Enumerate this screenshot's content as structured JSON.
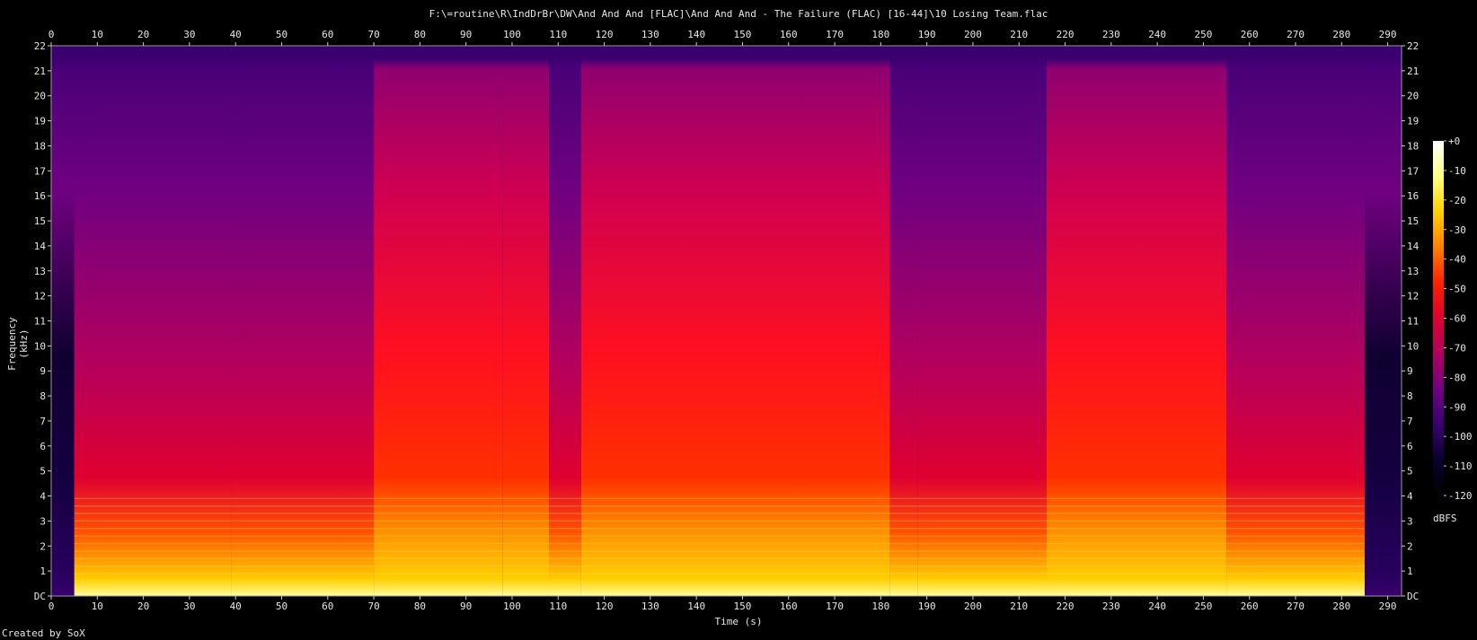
{
  "title": "F:\\=routine\\R\\IndDrBr\\DW\\And And And [FLAC]\\And And And - The Failure (FLAC) [16-44]\\10 Losing Team.flac",
  "credit": "Created by SoX",
  "chart_data": {
    "type": "heatmap",
    "title": "F:\\=routine\\R\\IndDrBr\\DW\\And And And [FLAC]\\And And And - The Failure (FLAC) [16-44]\\10 Losing Team.flac",
    "xlabel": "Time (s)",
    "ylabel": "Frequency (kHz)",
    "xlim": [
      0,
      293
    ],
    "ylim": [
      0,
      22
    ],
    "x_ticks": [
      "0",
      "10",
      "20",
      "30",
      "40",
      "50",
      "60",
      "70",
      "80",
      "90",
      "100",
      "110",
      "120",
      "130",
      "140",
      "150",
      "160",
      "170",
      "180",
      "190",
      "200",
      "210",
      "220",
      "230",
      "240",
      "250",
      "260",
      "270",
      "280",
      "290"
    ],
    "y_ticks": [
      "DC",
      "1",
      "2",
      "3",
      "4",
      "5",
      "6",
      "7",
      "8",
      "9",
      "10",
      "11",
      "12",
      "13",
      "14",
      "15",
      "16",
      "17",
      "18",
      "19",
      "20",
      "21",
      "22"
    ],
    "colorbar": {
      "label": "dBFS",
      "ticks": [
        "+0",
        "-10",
        "-20",
        "-30",
        "-40",
        "-50",
        "-60",
        "-70",
        "-80",
        "-90",
        "-100",
        "-110",
        "-120"
      ],
      "range": [
        -120,
        0
      ]
    },
    "colormap": [
      "#ffffff",
      "#ffff80",
      "#ffd000",
      "#ff8000",
      "#ff2000",
      "#e00030",
      "#b00060",
      "#700080",
      "#3a0070",
      "#0a0030",
      "#000000"
    ],
    "segments": [
      {
        "start": 0,
        "end": 1,
        "level": 0.05
      },
      {
        "start": 1,
        "end": 5,
        "level": 0.28
      },
      {
        "start": 5,
        "end": 39,
        "level": 0.55
      },
      {
        "start": 39,
        "end": 70,
        "level": 0.48
      },
      {
        "start": 70,
        "end": 98,
        "level": 0.85
      },
      {
        "start": 98,
        "end": 108,
        "level": 0.75
      },
      {
        "start": 108,
        "end": 115,
        "level": 0.45
      },
      {
        "start": 115,
        "end": 182,
        "level": 0.82
      },
      {
        "start": 182,
        "end": 188,
        "level": 0.42
      },
      {
        "start": 188,
        "end": 216,
        "level": 0.55
      },
      {
        "start": 216,
        "end": 255,
        "level": 0.85
      },
      {
        "start": 255,
        "end": 285,
        "level": 0.55
      },
      {
        "start": 285,
        "end": 293,
        "level": 0.12
      }
    ]
  }
}
